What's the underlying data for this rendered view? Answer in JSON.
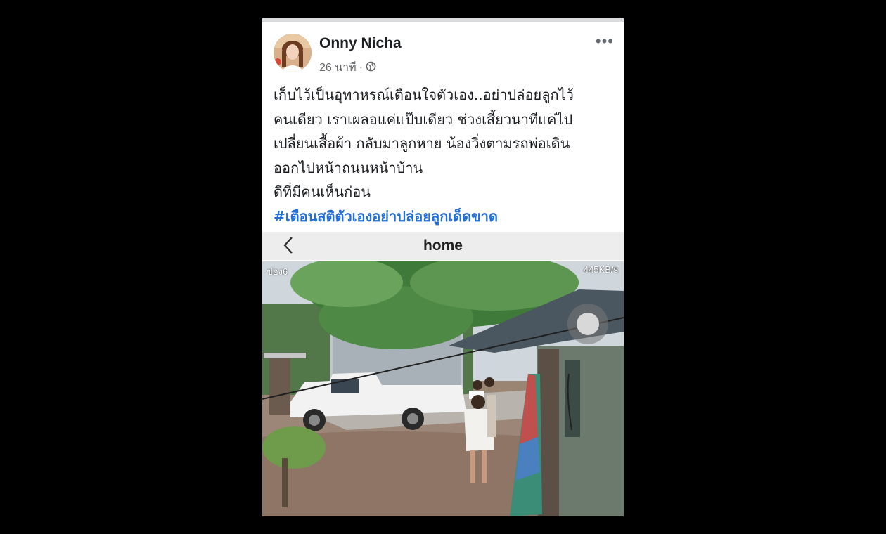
{
  "post": {
    "author": "Onny Nicha",
    "time": "26 นาที",
    "more_icon": "more-horizontal-icon",
    "privacy_icon": "globe-icon",
    "text_lines": [
      "เก็บไว้เป็นอุทาหรณ์เตือนใจตัวเอง..อย่าปล่อยลูกไว้",
      "คนเดียว เราเผลอแค่แป๊บเดียว ช่วงเสี้ยวนาทีแค่ไป",
      "เปลี่ยนเสื้อผ้า กลับมาลูกหาย น้องวิ่งตามรถพ่อเดิน",
      "ออกไปหน้าถนนหน้าบ้าน",
      "ดีที่มีคนเห็นก่อน"
    ],
    "hashtag": "#เตือนสติตัวเองอย่าปล่อยลูกเด็ดขาด"
  },
  "camera": {
    "back_icon": "chevron-left-icon",
    "title": "home",
    "channel": "ช่อง6",
    "bitrate": "445KB/s"
  },
  "colors": {
    "link": "#216fdb",
    "text": "#1c1e21",
    "muted": "#65676b",
    "background": "#000000"
  }
}
